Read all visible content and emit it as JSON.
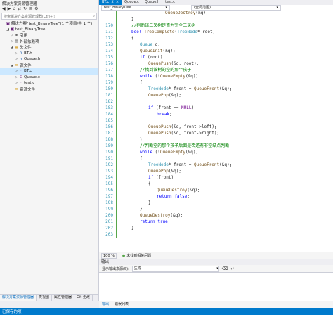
{
  "solution_explorer": {
    "title": "解决方案资源管理器",
    "search_placeholder": "搜索解决方案资源管理器(Ctrl+;)",
    "items": [
      {
        "label": "解决方案\"test_BinaryTree\"(1 个项目/共 1 个)",
        "icon": "solution-icon",
        "indent": 0,
        "tri": ""
      },
      {
        "label": "test_BinaryTree",
        "icon": "project-icon",
        "indent": 1,
        "tri": "◢"
      },
      {
        "label": "引用",
        "icon": "references-icon",
        "indent": 2,
        "tri": "▷"
      },
      {
        "label": "外部依赖项",
        "icon": "dependencies-icon",
        "indent": 2,
        "tri": "▷"
      },
      {
        "label": "头文件",
        "icon": "folder-icon",
        "indent": 2,
        "tri": "◢"
      },
      {
        "label": "BT.h",
        "icon": "header-file-icon",
        "indent": 3,
        "tri": "▷"
      },
      {
        "label": "Queue.h",
        "icon": "header-file-icon",
        "indent": 3,
        "tri": "▷"
      },
      {
        "label": "源文件",
        "icon": "folder-icon",
        "indent": 2,
        "tri": "◢"
      },
      {
        "label": "BT.c",
        "icon": "c-file-icon",
        "indent": 3,
        "tri": "▷",
        "selected": true
      },
      {
        "label": "Queue.c",
        "icon": "c-file-icon",
        "indent": 3,
        "tri": "▷"
      },
      {
        "label": "test.c",
        "icon": "c-file-icon",
        "indent": 3,
        "tri": "▷"
      },
      {
        "label": "资源文件",
        "icon": "folder-icon",
        "indent": 2,
        "tri": ""
      }
    ],
    "bottom_tabs": [
      "解决方案资源管理器",
      "类视图",
      "属性管理器",
      "Git 更改"
    ]
  },
  "editor": {
    "tabs": [
      {
        "label": "BT.c",
        "active": true
      },
      {
        "label": "Queue.c",
        "active": false
      },
      {
        "label": "Queue.h",
        "active": false
      },
      {
        "label": "test.c",
        "active": false
      }
    ],
    "nav_project": "test_BinaryTree",
    "nav_scope": "(全局范围)",
    "code_lines": [
      {
        "n": "",
        "html": "<span class=\"fn\">QueueDestroy</span>(&amp;q);",
        "indent": 4
      },
      {
        "n": "",
        "html": "}",
        "indent": 0
      },
      {
        "n": "",
        "html": "<span class=\"cm\">//判断该二叉树是否为完全二叉树</span>",
        "indent": 0
      },
      {
        "n": "",
        "html": "<span class=\"kw\">bool</span> <span class=\"fn\">TreeComplete</span>(<span class=\"ty\">TreeNode</span>* root)",
        "indent": 0
      },
      {
        "n": "",
        "html": "{",
        "indent": 0
      },
      {
        "n": "",
        "html": "<span class=\"ty\">Queue</span> q;",
        "indent": 1
      },
      {
        "n": "",
        "html": "<span class=\"fn\">QueueInit</span>(&amp;q);",
        "indent": 1
      },
      {
        "n": "",
        "html": "<span class=\"kw\">if</span> (root)",
        "indent": 1
      },
      {
        "n": "",
        "html": "<span class=\"fn\">QueuePush</span>(&amp;q, root);",
        "indent": 2
      },
      {
        "n": "",
        "html": "<span class=\"cm\">//找到该树的空的那个孩子</span>",
        "indent": 1
      },
      {
        "n": "",
        "html": "<span class=\"kw\">while</span> (!<span class=\"fn\">QueueEmpty</span>(&amp;q))",
        "indent": 1
      },
      {
        "n": "",
        "html": "{",
        "indent": 1
      },
      {
        "n": "",
        "html": "<span class=\"ty\">TreeNode</span>* front = <span class=\"fn\">QueueFront</span>(&amp;q);",
        "indent": 2
      },
      {
        "n": "",
        "html": "<span class=\"fn\">QueuePop</span>(&amp;q);",
        "indent": 2
      },
      {
        "n": "",
        "html": "",
        "indent": 0
      },
      {
        "n": "",
        "html": "<span class=\"kw\">if</span> (front == <span class=\"mc\">NULL</span>)",
        "indent": 2
      },
      {
        "n": "",
        "html": "<span class=\"kw\">break</span>;",
        "indent": 3
      },
      {
        "n": "",
        "html": "",
        "indent": 0
      },
      {
        "n": "",
        "html": "<span class=\"fn\">QueuePush</span>(&amp;q, front-&gt;left);",
        "indent": 2
      },
      {
        "n": "",
        "html": "<span class=\"fn\">QueuePush</span>(&amp;q, front-&gt;right);",
        "indent": 2
      },
      {
        "n": "",
        "html": "}",
        "indent": 1
      },
      {
        "n": "",
        "html": "<span class=\"cm\">//判断空的那个孩子后面是否还有非空结点判断</span>",
        "indent": 1
      },
      {
        "n": "",
        "html": "<span class=\"kw\">while</span> (!<span class=\"fn\">QueueEmpty</span>(&amp;q))",
        "indent": 1
      },
      {
        "n": "",
        "html": "{",
        "indent": 1
      },
      {
        "n": "",
        "html": "<span class=\"ty\">TreeNode</span>* front = <span class=\"fn\">QueueFront</span>(&amp;q);",
        "indent": 2
      },
      {
        "n": "",
        "html": "<span class=\"fn\">QueuePop</span>(&amp;q);",
        "indent": 2
      },
      {
        "n": "",
        "html": "<span class=\"kw\">if</span> (front)",
        "indent": 2
      },
      {
        "n": "",
        "html": "{",
        "indent": 2
      },
      {
        "n": "",
        "html": "<span class=\"fn\">QueueDestroy</span>(&amp;q);",
        "indent": 3
      },
      {
        "n": "",
        "html": "<span class=\"kw\">return</span> <span class=\"kw\">false</span>;",
        "indent": 3
      },
      {
        "n": "",
        "html": "}",
        "indent": 2
      },
      {
        "n": "",
        "html": "}",
        "indent": 1
      },
      {
        "n": "",
        "html": "<span class=\"fn\">QueueDestroy</span>(&amp;q);",
        "indent": 1
      },
      {
        "n": "",
        "html": "<span class=\"kw\">return</span> <span class=\"kw\">true</span>;",
        "indent": 1
      },
      {
        "n": "",
        "html": "}",
        "indent": 0
      },
      {
        "n": "",
        "html": "",
        "indent": 0
      }
    ],
    "line_numbers": [
      "",
      "",
      "170",
      "171",
      "172",
      "173",
      "174",
      "175",
      "176",
      "177",
      "178",
      "179",
      "180",
      "181",
      "182",
      "183",
      "184",
      "185",
      "186",
      "187",
      "188",
      "189",
      "190",
      "191",
      "192",
      "193",
      "194",
      "195",
      "196",
      "197",
      "198",
      "199",
      "200",
      "201",
      "202",
      "203"
    ],
    "zoom": "100 %",
    "issues": "未找到相关问题"
  },
  "output": {
    "title": "输出",
    "source_label": "显示输出来源(S):",
    "source_value": "生成",
    "tabs": [
      "输出",
      "错误列表"
    ]
  },
  "status": {
    "text": "已保存的项"
  },
  "colors": {
    "accent": "#007acc",
    "keyword": "#0000ff",
    "type": "#2b91af",
    "comment": "#008000"
  }
}
